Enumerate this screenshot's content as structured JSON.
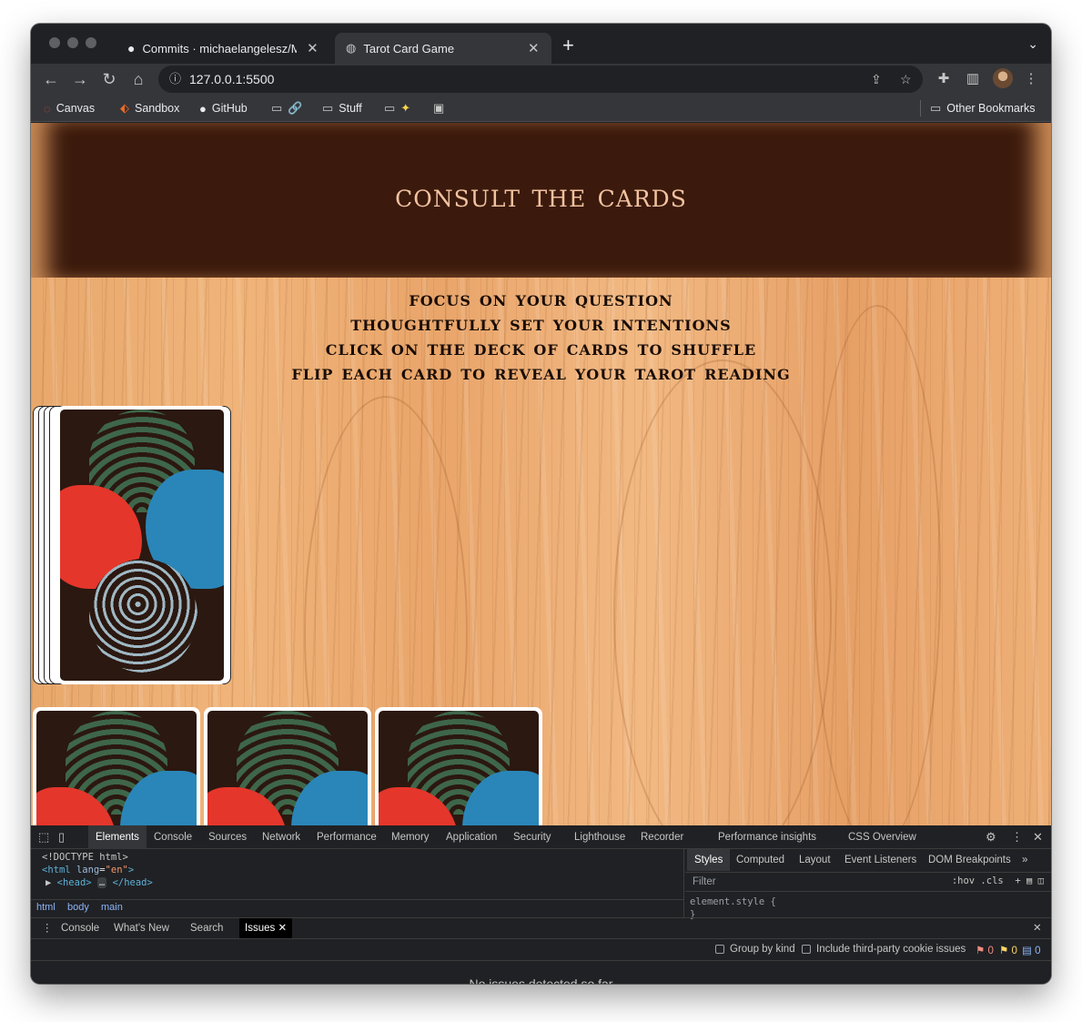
{
  "browser": {
    "tabs": [
      {
        "title": "Commits · michaelangelesz/Mi",
        "icon": "github-icon",
        "active": false
      },
      {
        "title": "Tarot Card Game",
        "icon": "globe-icon",
        "active": true
      }
    ],
    "url": "127.0.0.1:5500",
    "bookmarks": [
      "Canvas",
      "Sandbox",
      "GitHub",
      "",
      "Stuff",
      "",
      "",
      "Other Bookmarks"
    ]
  },
  "page": {
    "title": "consult the cards",
    "instructions": [
      "focus on your question",
      "thoughtfully set your intentions",
      "click on the deck of cards to shuffle",
      "flip each card to reveal your tarot reading"
    ]
  },
  "devtools": {
    "tabs": [
      "Elements",
      "Console",
      "Sources",
      "Network",
      "Performance",
      "Memory",
      "Application",
      "Security",
      "Lighthouse",
      "Recorder",
      "Performance insights",
      "CSS Overview"
    ],
    "code": {
      "doctype": "<!DOCTYPE html>",
      "html_open": "<html",
      "lang_attr": "lang",
      "lang_val": "\"en\"",
      "close_bracket": ">",
      "head": "<head>",
      "ellipsis": "…",
      "head_close": "</head>"
    },
    "breadcrumbs": [
      "html",
      "body",
      "main"
    ],
    "styles_tabs": [
      "Styles",
      "Computed",
      "Layout",
      "Event Listeners",
      "DOM Breakpoints"
    ],
    "filter_placeholder": "Filter",
    "filter_tools": ":hov  .cls",
    "element_style": "element.style {",
    "element_style_close": "}",
    "drawer_tabs": [
      "Console",
      "What's New",
      "Search",
      "Issues"
    ],
    "group_by_kind": "Group by kind",
    "third_party": "Include third-party cookie issues",
    "counts": {
      "errors": "0",
      "warnings": "0",
      "info": "0"
    },
    "no_issues": "No issues detected so far"
  },
  "colors": {
    "header_band": "#3b1a0d",
    "title_text": "#f2c2a0",
    "instruction_text": "#1a0d07",
    "card_red": "#e5362b",
    "card_blue": "#2a86b8"
  }
}
